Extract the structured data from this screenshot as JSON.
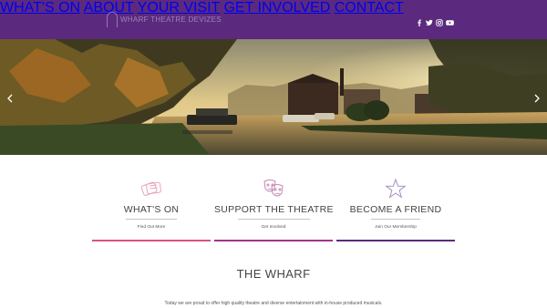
{
  "nav": {
    "logo_text": "WHARF THEATRE DEVIZES",
    "items": [
      "WHAT'S ON",
      "ABOUT",
      "YOUR VISIT",
      "GET INVOLVED",
      "CONTACT"
    ],
    "social_icons": [
      "facebook-icon",
      "twitter-icon",
      "instagram-icon",
      "youtube-icon"
    ]
  },
  "colors": {
    "nav_bg": "#5b2a7e",
    "pink": "#d8547c",
    "magenta": "#a1348e",
    "purple": "#5b2a7e"
  },
  "hero": {
    "slider_arrows": [
      "chevron-left-icon",
      "chevron-right-icon"
    ]
  },
  "cards": [
    {
      "icon": "tickets-icon",
      "title": "WHAT'S ON",
      "link": "Find Out More"
    },
    {
      "icon": "theatre-masks-icon",
      "title": "SUPPORT THE THEATRE",
      "link": "Get Involved"
    },
    {
      "icon": "star-icon",
      "title": "BECOME A FRIEND",
      "link": "Join Our Membership"
    }
  ],
  "section": {
    "title": "THE WHARF",
    "body": "Today we are proud to offer high quality theatre and diverse entertainment with in-house produced musicals."
  }
}
